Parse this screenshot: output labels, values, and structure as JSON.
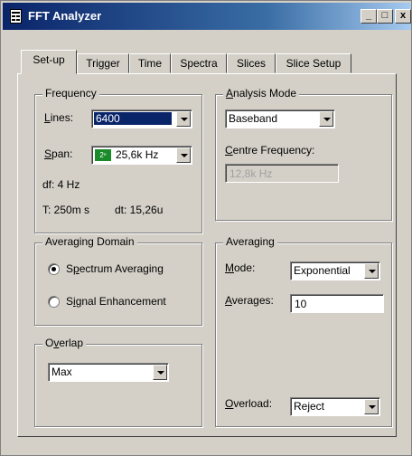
{
  "window": {
    "title": "FFT Analyzer"
  },
  "tabs": [
    {
      "label": "Set-up",
      "active": true
    },
    {
      "label": "Trigger"
    },
    {
      "label": "Time"
    },
    {
      "label": "Spectra"
    },
    {
      "label": "Slices"
    },
    {
      "label": "Slice Setup"
    }
  ],
  "frequency": {
    "legend": "Frequency",
    "lines_label": "Lines:",
    "lines_value": "6400",
    "span_label": "Span:",
    "span_badge": "2ⁿ",
    "span_value": "25,6k Hz",
    "df": "df: 4 Hz",
    "t": "T: 250m s",
    "dt": "dt: 15,26u"
  },
  "analysis_mode": {
    "legend": "Analysis Mode",
    "value": "Baseband",
    "centre_label": "Centre Frequency:",
    "centre_value": "12,8k Hz"
  },
  "averaging_domain": {
    "legend": "Averaging Domain",
    "options": [
      "Spectrum Averaging",
      "Signal Enhancement"
    ],
    "selected": "Spectrum Averaging"
  },
  "overlap": {
    "legend": "Overlap",
    "value": "Max"
  },
  "averaging": {
    "legend": "Averaging",
    "mode_label": "Mode:",
    "mode_value": "Exponential",
    "averages_label": "Averages:",
    "averages_value": "10",
    "overload_label": "Overload:",
    "overload_value": "Reject"
  }
}
